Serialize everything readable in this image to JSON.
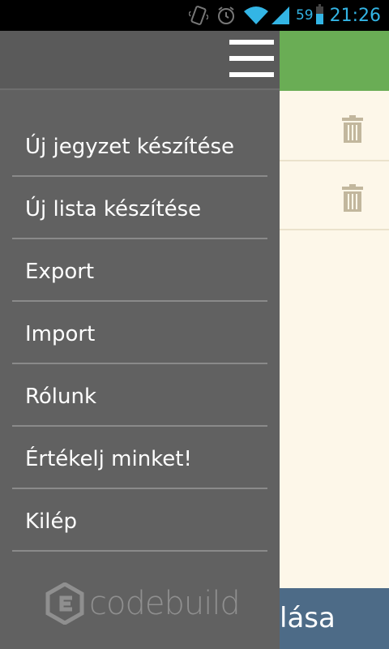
{
  "status_bar": {
    "battery_percent": "59",
    "time": "21:26",
    "icons": [
      "vibrate-icon",
      "alarm-icon",
      "wifi-icon",
      "signal-icon",
      "battery-icon"
    ],
    "accent_color": "#33b5e5"
  },
  "background_app": {
    "header_color": "#6aad55",
    "content_color": "#fdf7e9",
    "footer_color": "#4d6b87",
    "footer_text_visible": "lása",
    "row_icons": [
      "trash-icon",
      "trash-icon"
    ]
  },
  "drawer": {
    "background_color": "#616161",
    "menu_icon": "menu-icon",
    "items": [
      {
        "label": "Új jegyzet készítése"
      },
      {
        "label": "Új lista készítése"
      },
      {
        "label": "Export"
      },
      {
        "label": "Import"
      },
      {
        "label": "Rólunk"
      },
      {
        "label": "Értékelj minket!"
      },
      {
        "label": "Kilép"
      }
    ],
    "logo_text": "codebuild"
  }
}
